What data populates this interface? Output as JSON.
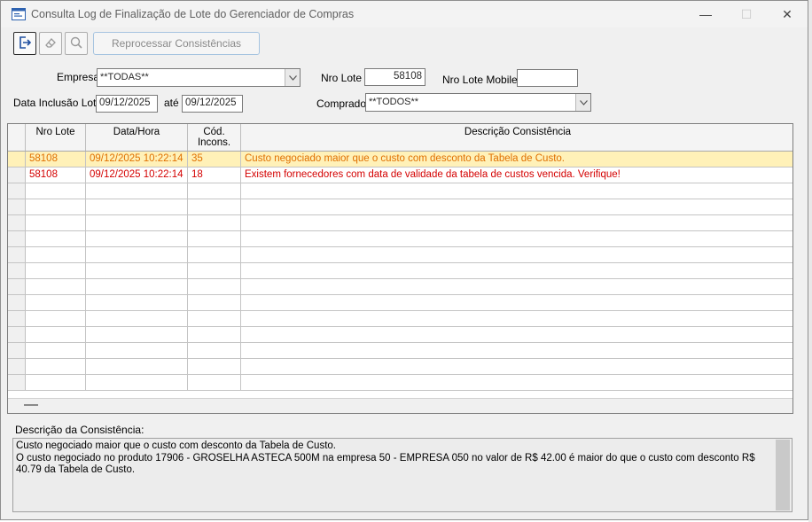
{
  "window": {
    "title": "Consulta Log de Finalização de Lote do Gerenciador de Compras",
    "minimize": "—",
    "maximize": "☐",
    "close": "✕"
  },
  "toolbar": {
    "exit_icon": "exit-icon",
    "eraser_icon": "eraser-icon",
    "search_icon": "search-icon",
    "reprocess_label": "Reprocessar Consistências"
  },
  "filters": {
    "empresa_label": "Empresa",
    "empresa_value": "**TODAS**",
    "nro_lote_label": "Nro Lote",
    "nro_lote_value": "58108",
    "nro_lote_mobile_label": "Nro Lote Mobile",
    "nro_lote_mobile_value": "",
    "data_inclusao_label": "Data Inclusão Lote",
    "data_inicio": "09/12/2025",
    "ate_label": "até",
    "data_fim": "09/12/2025",
    "comprador_label": "Comprador",
    "comprador_value": "**TODOS**"
  },
  "grid": {
    "columns": [
      "Nro Lote",
      "Data/Hora",
      "Cód.\nIncons.",
      "Descrição Consistência"
    ],
    "rows": [
      [
        "58108",
        "09/12/2025 10:22:14",
        "35",
        "Custo negociado maior que o custo com desconto da Tabela de Custo."
      ],
      [
        "58108",
        "09/12/2025 10:22:14",
        "18",
        "Existem fornecedores com data de validade da tabela de custos vencida. Verifique!"
      ]
    ],
    "highlight_color": "#fff1b8",
    "text_color": "#d40000"
  },
  "description": {
    "label": "Descrição da Consistência:",
    "lines": [
      "Custo negociado maior que o custo com desconto da Tabela de Custo.",
      "O custo negociado no produto 17906 - GROSELHA ASTECA 500M na empresa 50 - EMPRESA 050 no valor de R$ 42.00 é maior do que o custo com desconto R$ 40.79 da Tabela de Custo."
    ]
  }
}
